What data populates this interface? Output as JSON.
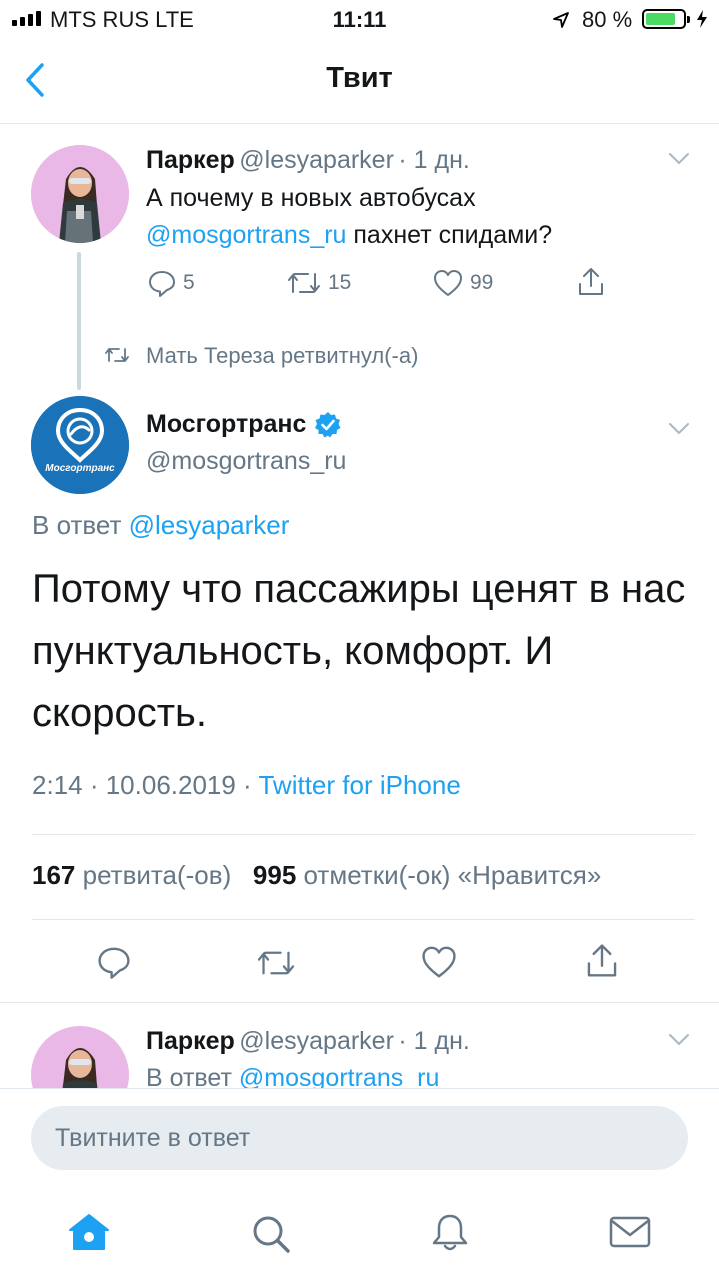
{
  "status_bar": {
    "carrier": "MTS RUS  LTE",
    "time": "11:11",
    "battery_percent": "80 %",
    "battery_level": 0.8
  },
  "nav": {
    "title": "Твит"
  },
  "parent_tweet": {
    "name": "Паркер",
    "handle": "@lesyaparker",
    "time": "· 1 дн.",
    "text_prefix": "А почему в новых автобусах",
    "mention": "@mosgortrans_ru",
    "text_suffix": " пахнет спидами?",
    "replies": "5",
    "retweets": "15",
    "likes": "99"
  },
  "retweet_note": "Мать Тереза ретвитнул(-а)",
  "main_tweet": {
    "name": "Мосгортранс",
    "handle": "@mosgortrans_ru",
    "avatar_label": "Мосгортранс",
    "reply_to_prefix": "В ответ ",
    "reply_to": "@lesyaparker",
    "text": "Потому что пассажиры ценят в нас пунктуальность, комфорт. И скорость.",
    "timestamp": "2:14 · 10.06.2019 · ",
    "source": "Twitter for iPhone",
    "retweet_count": "167",
    "retweet_label": " ретвита(-ов)",
    "like_count": "995",
    "like_label": " отметки(-ок) «Нравится»"
  },
  "next_tweet": {
    "name": "Паркер",
    "handle": "@lesyaparker",
    "time": "· 1 дн.",
    "reply_prefix": "В ответ ",
    "reply_to": "@mosgortrans_ru"
  },
  "reply_box": {
    "placeholder": "Твитните в ответ"
  },
  "tab_bar": [
    "home-icon",
    "search-icon",
    "notifications-icon",
    "messages-icon"
  ],
  "colors": {
    "accent": "#1da1f2",
    "secondary_text": "#657786",
    "battery": "#4cd964"
  }
}
